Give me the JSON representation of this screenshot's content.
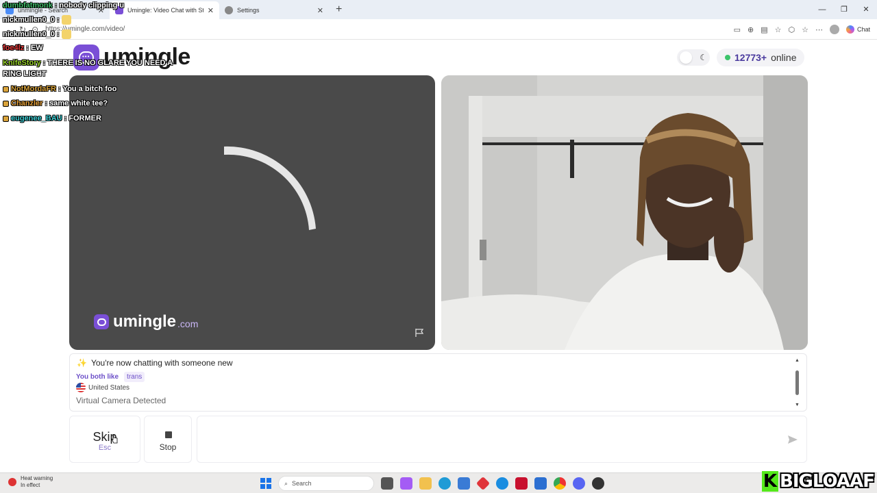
{
  "browser": {
    "tabs": [
      {
        "title": "unmingle - Search",
        "color": "#4a8cf7"
      },
      {
        "title": "Umingle: Video Chat with Str",
        "color": "#7a4fd6"
      },
      {
        "title": "Settings",
        "color": "#777777"
      }
    ],
    "url": "https://umingle.com/video/",
    "chat_label": "Chat"
  },
  "site": {
    "logo_text": "umingle",
    "online_count": "12773+",
    "online_label": "online",
    "watermark_text": "umingle",
    "watermark_domain": ".com"
  },
  "chatbox": {
    "line1": "You're now chatting with someone new",
    "both_like_label": "You both like",
    "interest_tag": "trans",
    "country": "United States",
    "notice": "Virtual Camera Detected"
  },
  "controls": {
    "skip_label": "Skip",
    "skip_hint": "Esc",
    "stop_label": "Stop",
    "message_placeholder": ""
  },
  "stream_chat": [
    {
      "user": "dumbfatmonk",
      "text": "nobody clipping u",
      "color": "#3fbf6a",
      "emote": false,
      "badge": false
    },
    {
      "user": "nickmullen0_0",
      "text": "",
      "color": "#ffffff",
      "emote": true,
      "badge": false
    },
    {
      "user": "nickmullen0_0",
      "text": "",
      "color": "#ffffff",
      "emote": true,
      "badge": false
    },
    {
      "user": "foe4lz",
      "text": "EW",
      "color": "#e53b3b",
      "emote": false,
      "badge": false
    },
    {
      "user": "KnifeStory",
      "text": "THERE IS NO GLARE YOU NEED A",
      "color": "#9ad42b",
      "emote": false,
      "badge": false
    },
    {
      "user": "",
      "text": "RING LIGHT",
      "color": "#ffffff",
      "emote": false,
      "badge": false
    },
    {
      "user": "NotMordaFR",
      "text": "You a bitch foo",
      "color": "#d9a33b",
      "emote": false,
      "badge": true
    },
    {
      "user": "Chanzler",
      "text": "same white tee?",
      "color": "#e8a23a",
      "emote": false,
      "badge": true
    },
    {
      "user": "eugenee_BAU",
      "text": "FORMER",
      "color": "#3fd0d6",
      "emote": false,
      "badge": true
    }
  ],
  "taskbar": {
    "heat_title": "Heat warning",
    "heat_sub": "In effect",
    "search_placeholder": "Search"
  },
  "streamer_tag": {
    "k": "K",
    "name": "BIGLOAAF"
  }
}
